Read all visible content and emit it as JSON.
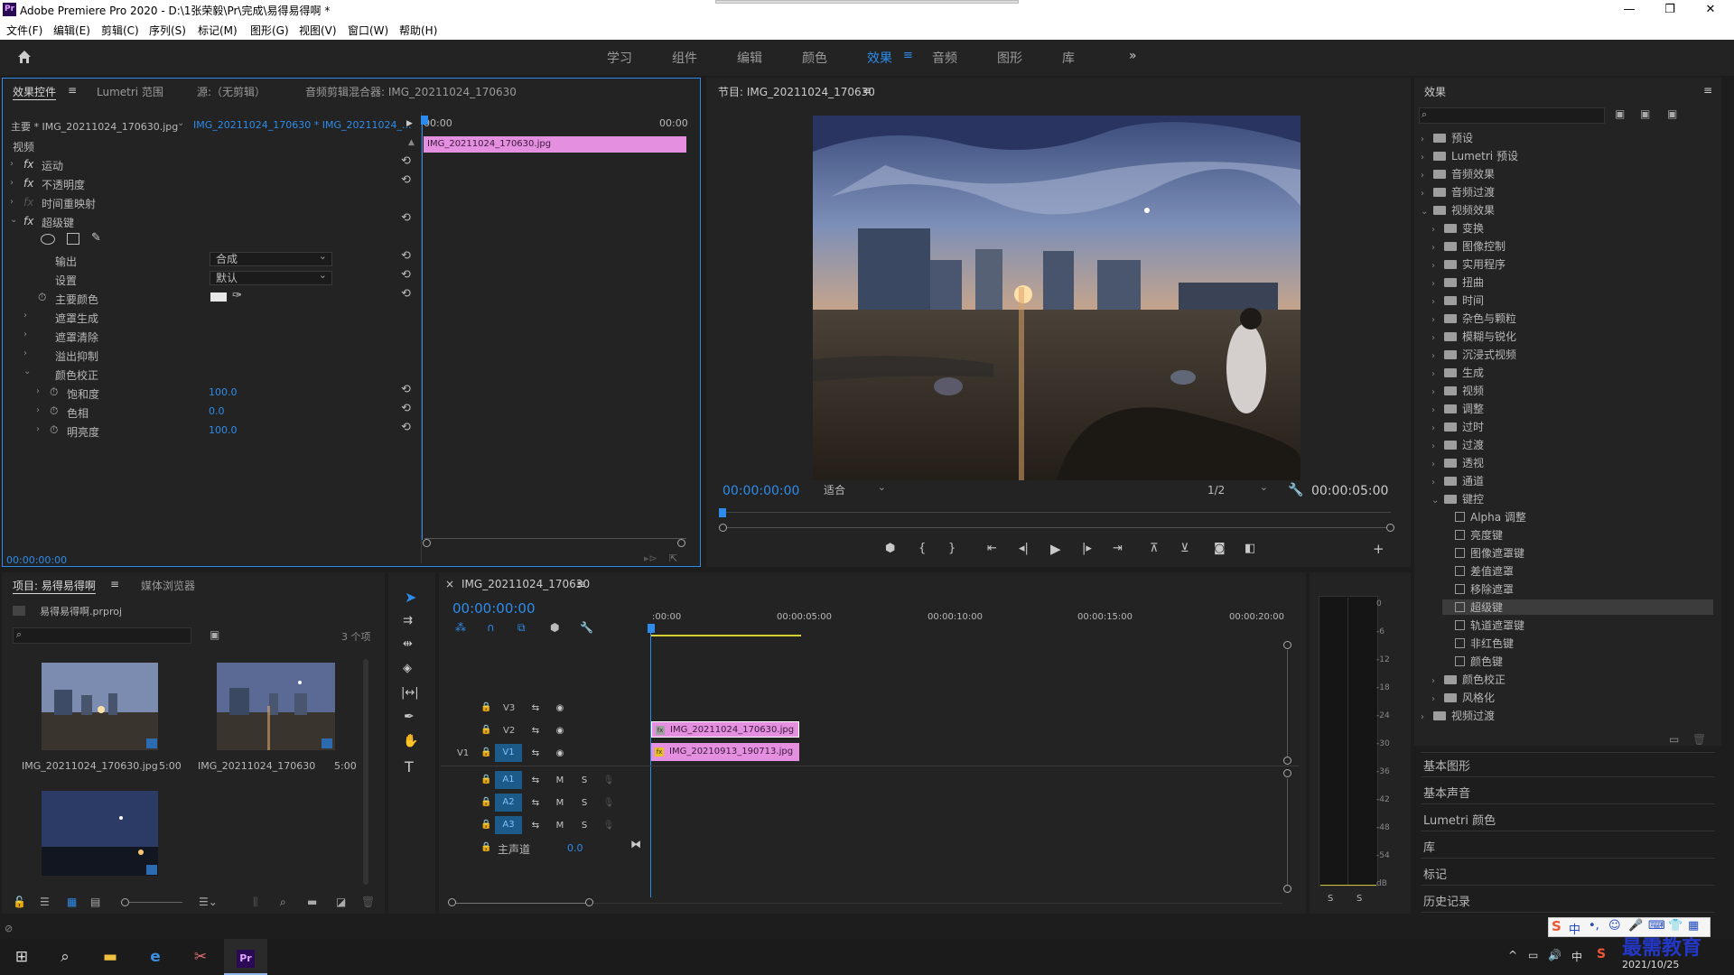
{
  "window": {
    "title": "Adobe Premiere Pro 2020 - D:\\1张荣毅\\Pr\\完成\\易得易得啊 *",
    "minimize": "—",
    "maximize": "❐",
    "close": "✕"
  },
  "menu": [
    "文件(F)",
    "编辑(E)",
    "剪辑(C)",
    "序列(S)",
    "标记(M)",
    "图形(G)",
    "视图(V)",
    "窗口(W)",
    "帮助(H)"
  ],
  "workspaces": [
    "学习",
    "组件",
    "编辑",
    "颜色",
    "效果",
    "音频",
    "图形",
    "库"
  ],
  "active_workspace": "效果",
  "effect_controls": {
    "tabs": [
      "效果控件",
      "Lumetri 范围",
      "源:（无剪辑）",
      "音频剪辑混合器: IMG_20211024_170630"
    ],
    "master_clip": "主要 * IMG_20211024_170630.jpg",
    "seq_clip": "IMG_20211024_170630 * IMG_20211024_...",
    "time_start": "00:00",
    "time_end": "00:00",
    "clip_label": "IMG_20211024_170630.jpg",
    "section": "视频",
    "effects": [
      "运动",
      "不透明度",
      "时间重映射",
      "超级键"
    ],
    "output_label": "输出",
    "output_value": "合成",
    "setting_label": "设置",
    "setting_value": "默认",
    "key_color_label": "主要颜色",
    "groups": [
      "遮罩生成",
      "遮罩清除",
      "溢出抑制",
      "颜色校正"
    ],
    "params": [
      {
        "label": "饱和度",
        "value": "100.0"
      },
      {
        "label": "色相",
        "value": "0.0"
      },
      {
        "label": "明亮度",
        "value": "100.0"
      }
    ],
    "timecode": "00:00:00:00"
  },
  "program": {
    "title": "节目: IMG_20211024_170630",
    "timecode": "00:00:00:00",
    "fit": "适合",
    "resolution": "1/2",
    "duration": "00:00:05:00"
  },
  "project": {
    "tabs": [
      "项目: 易得易得啊",
      "媒体浏览器"
    ],
    "file": "易得易得啊.prproj",
    "count": "3 个项",
    "items": [
      {
        "name": "IMG_20211024_170630.jpg",
        "dur": "5:00"
      },
      {
        "name": "IMG_20211024_170630",
        "dur": "5:00"
      },
      {
        "name": "",
        "dur": ""
      }
    ]
  },
  "timeline": {
    "tab": "IMG_20211024_170630",
    "timecode": "00:00:00:00",
    "ruler": [
      ":00:00",
      "00:00:05:00",
      "00:00:10:00",
      "00:00:15:00",
      "00:00:20:00"
    ],
    "video_tracks": [
      "V3",
      "V2",
      "V1"
    ],
    "audio_tracks": [
      "A1",
      "A2",
      "A3"
    ],
    "src_patch": "V1",
    "mute": "M",
    "solo": "S",
    "master": "主声道",
    "master_val": "0.0",
    "clips": [
      {
        "track": "V2",
        "name": "IMG_20211024_170630.jpg"
      },
      {
        "track": "V1",
        "name": "IMG_20210913_190713.jpg"
      }
    ]
  },
  "meter": {
    "scale": [
      "0",
      "-6",
      "-12",
      "-18",
      "-24",
      "-30",
      "-36",
      "-42",
      "-48",
      "-54",
      "dB"
    ],
    "solo": [
      "S",
      "S"
    ]
  },
  "effects_panel": {
    "title": "效果",
    "tree": [
      {
        "l": "预设",
        "d": 0
      },
      {
        "l": "Lumetri 预设",
        "d": 0
      },
      {
        "l": "音频效果",
        "d": 0
      },
      {
        "l": "音频过渡",
        "d": 0
      },
      {
        "l": "视频效果",
        "d": 0,
        "open": true
      },
      {
        "l": "变换",
        "d": 1
      },
      {
        "l": "图像控制",
        "d": 1
      },
      {
        "l": "实用程序",
        "d": 1
      },
      {
        "l": "扭曲",
        "d": 1
      },
      {
        "l": "时间",
        "d": 1
      },
      {
        "l": "杂色与颗粒",
        "d": 1
      },
      {
        "l": "模糊与锐化",
        "d": 1
      },
      {
        "l": "沉浸式视频",
        "d": 1
      },
      {
        "l": "生成",
        "d": 1
      },
      {
        "l": "视频",
        "d": 1
      },
      {
        "l": "调整",
        "d": 1
      },
      {
        "l": "过时",
        "d": 1
      },
      {
        "l": "过渡",
        "d": 1
      },
      {
        "l": "透视",
        "d": 1
      },
      {
        "l": "通道",
        "d": 1
      },
      {
        "l": "键控",
        "d": 1,
        "open": true
      },
      {
        "l": "Alpha 调整",
        "d": 2
      },
      {
        "l": "亮度键",
        "d": 2
      },
      {
        "l": "图像遮罩键",
        "d": 2
      },
      {
        "l": "差值遮罩",
        "d": 2
      },
      {
        "l": "移除遮罩",
        "d": 2
      },
      {
        "l": "超级键",
        "d": 2,
        "selected": true
      },
      {
        "l": "轨道遮罩键",
        "d": 2
      },
      {
        "l": "非红色键",
        "d": 2
      },
      {
        "l": "颜色键",
        "d": 2
      },
      {
        "l": "颜色校正",
        "d": 1
      },
      {
        "l": "风格化",
        "d": 1
      },
      {
        "l": "视频过渡",
        "d": 0
      }
    ],
    "panels": [
      "基本图形",
      "基本声音",
      "Lumetri 颜色",
      "库",
      "标记",
      "历史记录"
    ]
  },
  "taskbar": {
    "date": "2021/10/25",
    "ime": "中",
    "logo": "最需教育"
  }
}
